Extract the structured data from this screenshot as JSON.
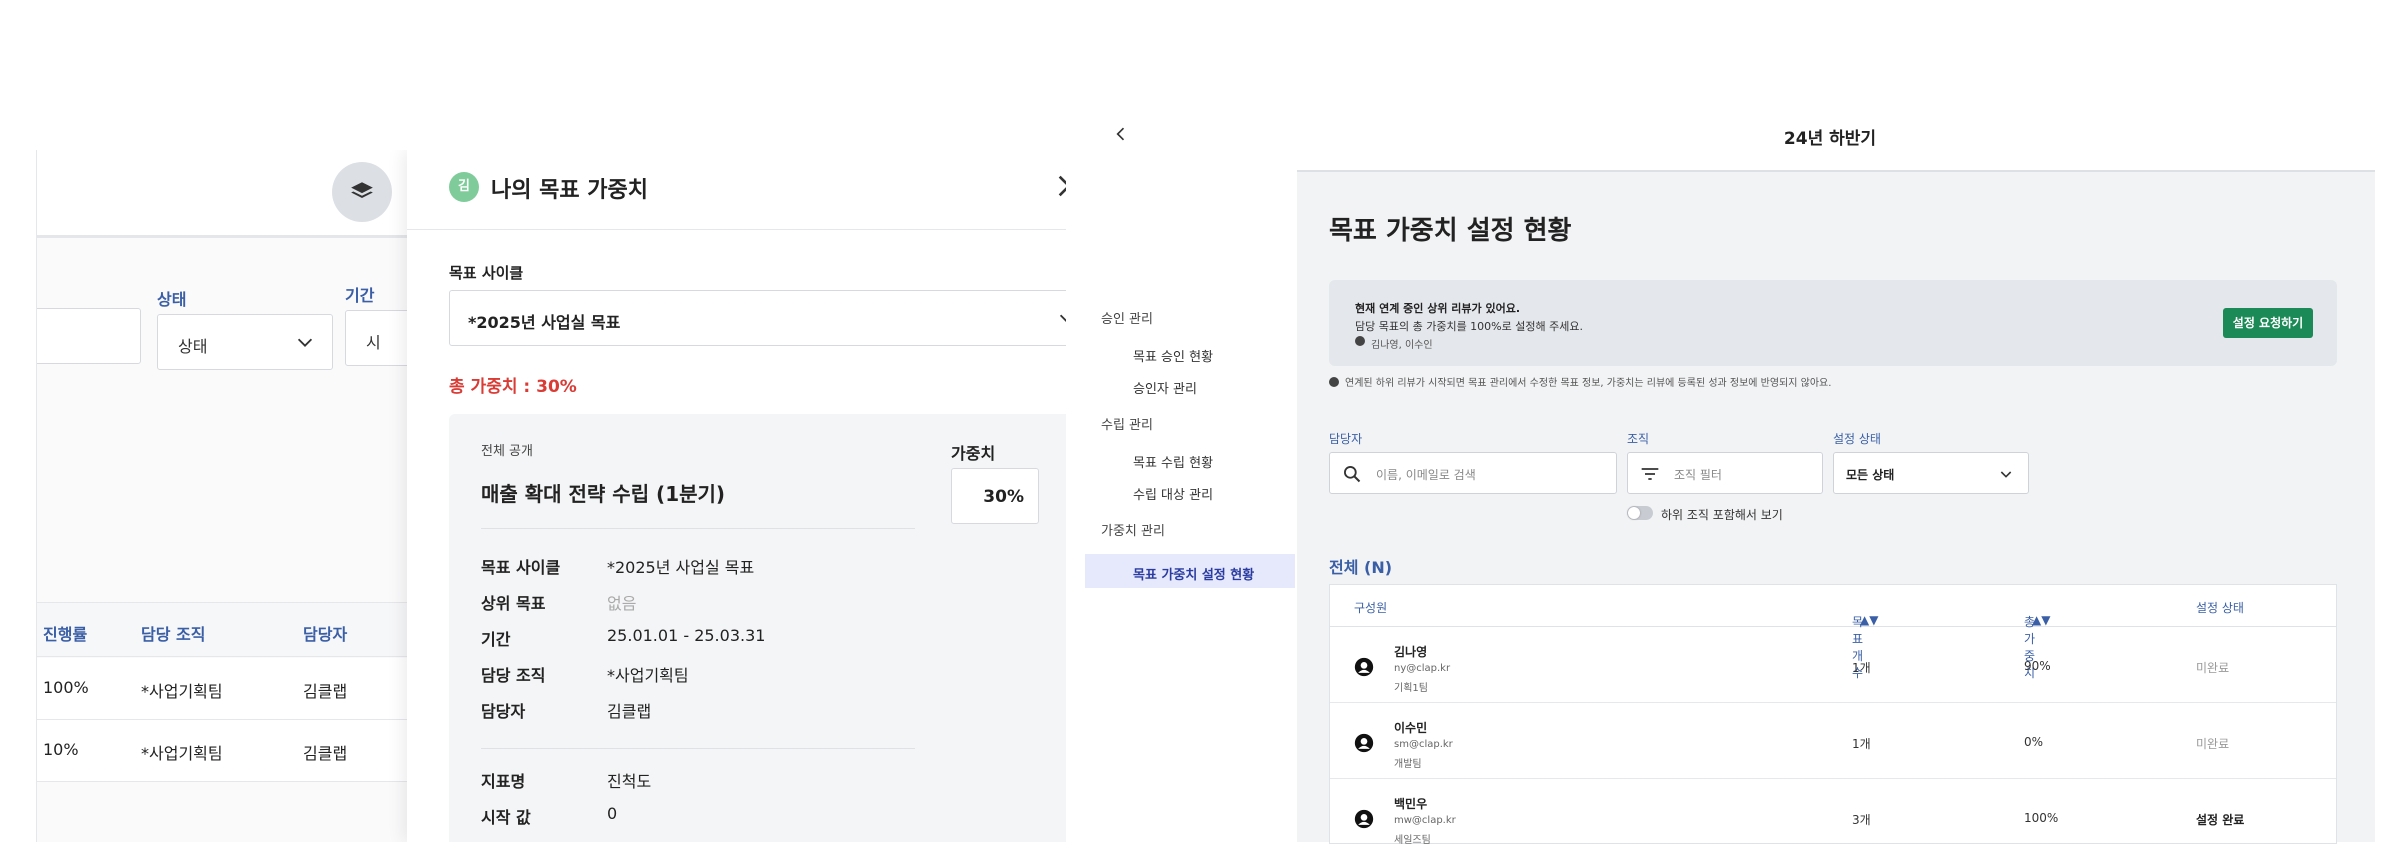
{
  "left_app": {
    "filters": {
      "status_label": "상태",
      "status_value": "상태",
      "period_label": "기간",
      "period_value": "시"
    },
    "table": {
      "headers": [
        "진행률",
        "담당 조직",
        "담당자"
      ],
      "rows": [
        {
          "progress": "100%",
          "org": "*사업기획팀",
          "owner": "김클랩"
        },
        {
          "progress": "10%",
          "org": "*사업기획팀",
          "owner": "김클랩"
        }
      ]
    }
  },
  "modal": {
    "avatar_text": "김",
    "title": "나의 목표 가중치",
    "cycle_label": "목표 사이클",
    "cycle_value": "*2025년 사업실 목표",
    "total_weight": "총 가중치 : 30%",
    "card": {
      "visibility": "전체 공개",
      "weight_label": "가중치",
      "weight_value": "30%",
      "goal_name": "매출 확대 전략 수립 (1분기)",
      "details": [
        {
          "key": "목표 사이클",
          "value": "*2025년 사업실 목표"
        },
        {
          "key": "상위 목표",
          "value": "없음"
        },
        {
          "key": "기간",
          "value": "25.01.01 - 25.03.31"
        },
        {
          "key": "담당 조직",
          "value": "*사업기획팀"
        },
        {
          "key": "담당자",
          "value": "김클랩"
        }
      ],
      "metrics": [
        {
          "key": "지표명",
          "value": "진척도"
        },
        {
          "key": "시작 값",
          "value": "0"
        }
      ]
    }
  },
  "right_app": {
    "period": "24년 하반기",
    "nav": {
      "groups": [
        {
          "label": "승인 관리",
          "items": [
            "목표 승인 현황",
            "승인자 관리"
          ]
        },
        {
          "label": "수립 관리",
          "items": [
            "목표 수립 현황",
            "수립 대상 관리"
          ]
        },
        {
          "label": "가중치 관리",
          "items": [
            "목표 가중치 설정 현황"
          ]
        }
      ]
    },
    "title": "목표 가중치 설정 현황",
    "notice": {
      "line1": "현재 연계 중인 상위 리뷰가 있어요.",
      "line2": "담당 목표의 총 가중치를 100%로 설정해 주세요.",
      "line3": "김나영, 이수인",
      "button": "설정 요청하기"
    },
    "sub_note": "연계된 하위 리뷰가 시작되면 목표 관리에서 수정한 목표 정보, 가중치는 리뷰에 등록된 성과 정보에 반영되지 않아요.",
    "filters": {
      "owner_label": "담당자",
      "owner_placeholder": "이름, 이메일로 검색",
      "org_label": "조직",
      "org_placeholder": "조직 필터",
      "status_label": "설정 상태",
      "status_value": "모든 상태",
      "toggle_label": "하위 조직 포함해서 보기"
    },
    "list_title": "전체 (N)",
    "table": {
      "headers": [
        "구성원",
        "목표 개수",
        "총 가중치",
        "설정 상태"
      ],
      "rows": [
        {
          "name": "김나영",
          "email": "ny@clap.kr",
          "team": "기획1팀",
          "count": "1개",
          "weight": "90%",
          "status": "미완료"
        },
        {
          "name": "이수민",
          "email": "sm@clap.kr",
          "team": "개발팀",
          "count": "1개",
          "weight": "0%",
          "status": "미완료"
        },
        {
          "name": "백민우",
          "email": "mw@clap.kr",
          "team": "세일즈팀",
          "count": "3개",
          "weight": "100%",
          "status": "설정 완료"
        }
      ]
    }
  }
}
